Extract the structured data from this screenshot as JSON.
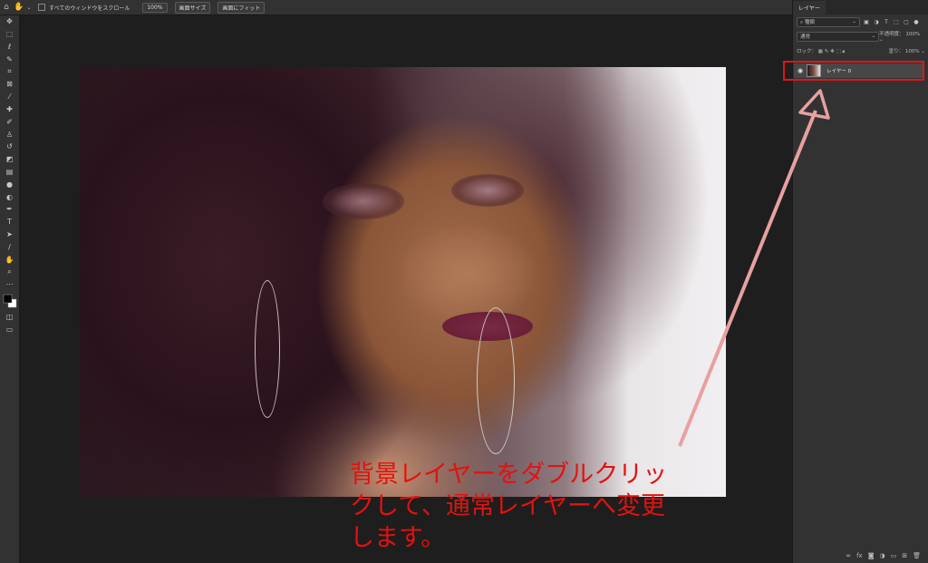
{
  "top_bar": {
    "scroll_all_label": "すべてのウィンドウをスクロール",
    "zoom_100_label": "100%",
    "fit_screen_size_label": "画面サイズ",
    "fit_screen_label": "画面にフィット"
  },
  "layers_panel": {
    "tab_label": "レイヤー",
    "kind_filter": "種類",
    "blend_mode": "通常",
    "opacity_label": "不透明度：",
    "opacity_value": "100%",
    "lock_label": "ロック：",
    "fill_label": "塗り：",
    "fill_value": "100%",
    "layers": [
      {
        "name": "レイヤー 0",
        "visible": true
      }
    ]
  },
  "annotation": {
    "line1": "背景レイヤーをダブルクリッ",
    "line2": "クして、通常レイヤーへ変更",
    "line3": "します。",
    "color": "#e3120f",
    "arrow_color": "#e8a0a0",
    "highlight_color": "#e01616"
  }
}
